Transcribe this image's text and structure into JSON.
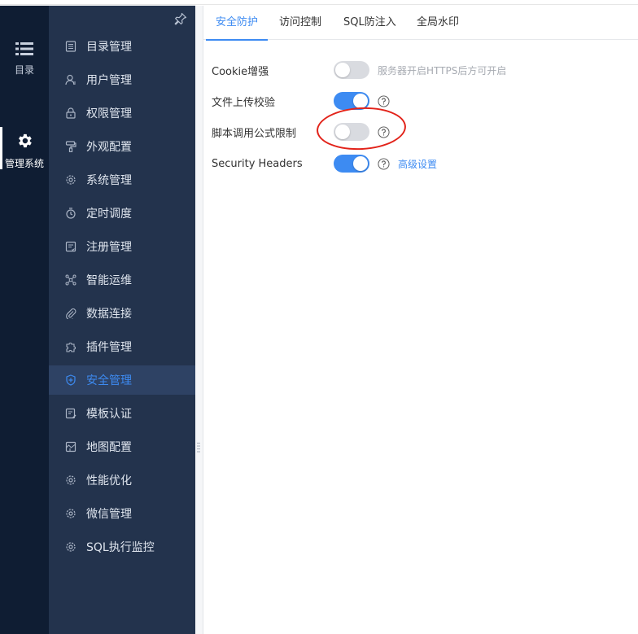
{
  "rail": {
    "items": [
      {
        "label": "目录",
        "icon": "list-icon"
      },
      {
        "label": "管理系统",
        "icon": "gear-icon"
      }
    ]
  },
  "menu": {
    "pin_icon": "pin-icon",
    "items": [
      {
        "label": "目录管理"
      },
      {
        "label": "用户管理"
      },
      {
        "label": "权限管理"
      },
      {
        "label": "外观配置"
      },
      {
        "label": "系统管理"
      },
      {
        "label": "定时调度"
      },
      {
        "label": "注册管理"
      },
      {
        "label": "智能运维"
      },
      {
        "label": "数据连接"
      },
      {
        "label": "插件管理"
      },
      {
        "label": "安全管理"
      },
      {
        "label": "模板认证"
      },
      {
        "label": "地图配置"
      },
      {
        "label": "性能优化"
      },
      {
        "label": "微信管理"
      },
      {
        "label": "SQL执行监控"
      }
    ],
    "active_index": 10
  },
  "tabs": [
    {
      "label": "安全防护"
    },
    {
      "label": "访问控制"
    },
    {
      "label": "SQL防注入"
    },
    {
      "label": "全局水印"
    }
  ],
  "settings": [
    {
      "label": "Cookie增强",
      "enabled": false,
      "hint": "服务器开启HTTPS后方可开启"
    },
    {
      "label": "文件上传校验",
      "enabled": true
    },
    {
      "label": "脚本调用公式限制",
      "enabled": false
    },
    {
      "label": "Security Headers",
      "enabled": true,
      "link": "高级设置"
    }
  ],
  "colors": {
    "accent": "#3d8bf2",
    "rail_bg": "#0f1d33",
    "menu_bg": "#23334d",
    "menu_active_bg": "#2e4264",
    "annotation": "#e2231a"
  }
}
